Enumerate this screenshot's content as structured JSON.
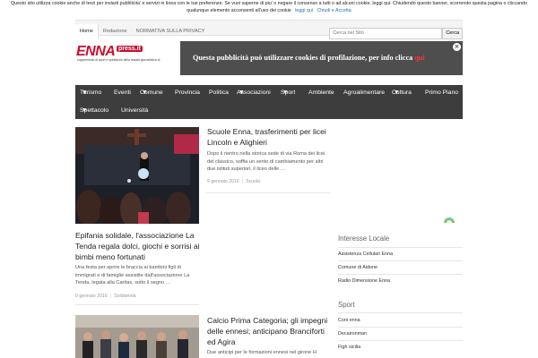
{
  "cookie": {
    "line1": "Questo sito utilizza cookie anche di terzi per inviarti pubblicita' e servizi in linea con le tue preferenze. Se vuoi saperne di piu' o negare il consenso a tutti o ad alcuni cookie, leggi qui. Chiudendo questo banner, scorrendo questa pagina o cliccando",
    "line2": "qualunque elemento acconsenti all'uso dei cookie",
    "link_read": "leggi qui",
    "link_close": "Chiudi e Accetta"
  },
  "topnav": {
    "tabs": [
      "Home",
      "Redazione",
      "NORMATIVA SULLA PRIVACY"
    ]
  },
  "search": {
    "placeholder": "Cerca nel Sito",
    "button": "Cerca"
  },
  "logo": {
    "name": "ENNA",
    "badge": "press.it",
    "tagline": "supplemento di sport e spettacolo della testata giornalistica di"
  },
  "ad": {
    "text": "Questa pubblicità può utilizzare cookies di profilazione, per info clicca",
    "link": "qui",
    "close_icon": "×"
  },
  "mainnav": {
    "row1": [
      {
        "label": "Turismo",
        "dropdown": true
      },
      {
        "label": "Eventi",
        "dropdown": false
      },
      {
        "label": "Comune",
        "dropdown": true
      },
      {
        "label": "Provincia",
        "dropdown": false
      },
      {
        "label": "Politica",
        "dropdown": false
      },
      {
        "label": "Associazioni",
        "dropdown": true
      },
      {
        "label": "Sport",
        "dropdown": true
      },
      {
        "label": "Ambiente",
        "dropdown": false
      },
      {
        "label": "Agroalimentare",
        "dropdown": false
      },
      {
        "label": "Cultura",
        "dropdown": true
      },
      {
        "label": "Primo Piano",
        "dropdown": false
      }
    ],
    "row2": [
      {
        "label": "Spettacolo",
        "dropdown": true
      },
      {
        "label": "Università",
        "dropdown": false
      }
    ]
  },
  "articles": [
    {
      "title": "Scuole Enna, trasferimenti per licei Lincoln e Alighieri",
      "excerpt": "Dopo il rientro nella storica sede di via Roma dei licei del classico, soffia un vento di cambiamento per altri due istituti superiori, il liceo delle …",
      "date": "9 gennaio 2016",
      "category": "Scuola"
    },
    {
      "title": "Epifania solidale, l'associazione La Tenda regala dolci, giochi e sorrisi ai bimbi meno fortunati",
      "excerpt": "Una festa per aprire le braccia ai bambini figli di immigrati e di famiglie assistite dall'associazione La Tenda, legata alla Caritas, sotto il segno …",
      "date": "9 gennaio 2016",
      "category": "Solidarietà"
    },
    {
      "title": "Calcio Prima Categoria; gli impegni delle ennesi; anticipano Branciforti ed Agira",
      "excerpt": "Due anticipi per le formazioni ennesi nel girone H"
    }
  ],
  "sidebar": {
    "section1": {
      "heading": "Interesse Locale",
      "items": [
        "Assistenza Cellulari Enna",
        "Comune di Aidone",
        "Radio Dimensione Enna"
      ]
    },
    "section2": {
      "heading": "Sport",
      "items": [
        "Coni enna",
        "Decaironman",
        "Figh sicilia"
      ]
    }
  }
}
